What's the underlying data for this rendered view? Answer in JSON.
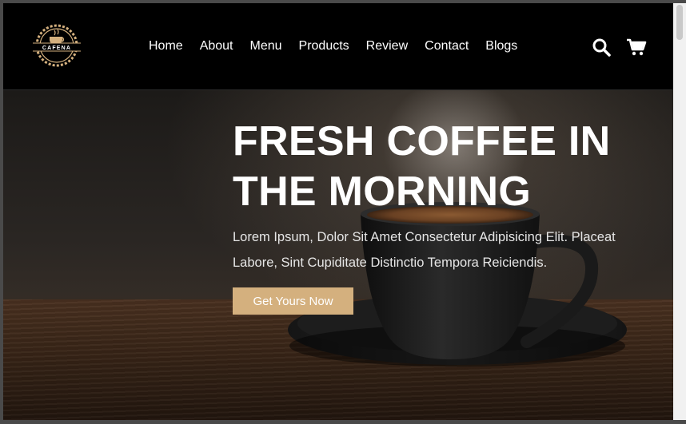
{
  "brand": {
    "logo_text": "CAFENA"
  },
  "nav": {
    "items": [
      {
        "label": "Home"
      },
      {
        "label": "About"
      },
      {
        "label": "Menu"
      },
      {
        "label": "Products"
      },
      {
        "label": "Review"
      },
      {
        "label": "Contact"
      },
      {
        "label": "Blogs"
      }
    ]
  },
  "header_icons": [
    "search-icon",
    "cart-icon"
  ],
  "hero": {
    "title_line1": "FRESH COFFEE IN",
    "title_line2": "THE MORNING",
    "text_line1": "Lorem Ipsum, Dolor Sit Amet Consectetur Adipisicing Elit. Placeat",
    "text_line2": "Labore, Sint Cupiditate Distinctio Tempora Reiciendis.",
    "cta_label": "Get Yours Now"
  },
  "colors": {
    "header_bg": "#000000",
    "accent": "#d4b07e",
    "text": "#ffffff"
  }
}
